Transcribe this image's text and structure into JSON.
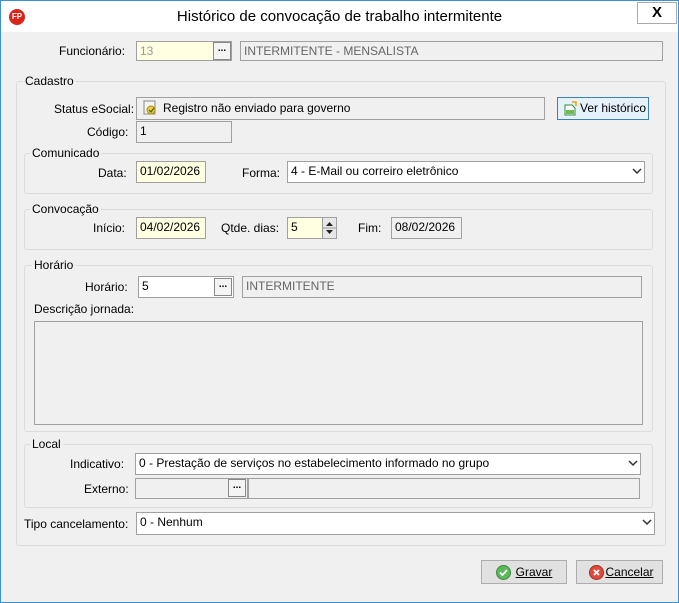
{
  "window": {
    "title": "Histórico de convocação de trabalho intermitente",
    "app_icon_text": "FP",
    "close_label": "X"
  },
  "funcionario": {
    "label": "Funcionário:",
    "value": "13",
    "description": "INTERMITENTE - MENSALISTA"
  },
  "cadastro": {
    "title": "Cadastro",
    "status_label": "Status eSocial:",
    "status_value": "Registro não enviado para governo",
    "ver_historico_label": "Ver histórico",
    "codigo_label": "Código:",
    "codigo_value": "1"
  },
  "comunicado": {
    "title": "Comunicado",
    "data_label": "Data:",
    "data_value": "01/02/2026",
    "forma_label": "Forma:",
    "forma_value": "4 - E-Mail ou correiro eletrônico"
  },
  "convocacao": {
    "title": "Convocação",
    "inicio_label": "Início:",
    "inicio_value": "04/02/2026",
    "qtde_label": "Qtde. dias:",
    "qtde_value": "5",
    "fim_label": "Fim:",
    "fim_value": "08/02/2026"
  },
  "horario": {
    "title": "Horário",
    "horario_label": "Horário:",
    "horario_value": "5",
    "horario_desc": "INTERMITENTE",
    "descricao_label": "Descrição jornada:",
    "descricao_value": ""
  },
  "local": {
    "title": "Local",
    "indicativo_label": "Indicativo:",
    "indicativo_value": "0 - Prestação de serviços no estabelecimento informado no grupo",
    "externo_label": "Externo:",
    "externo_value": "",
    "externo_desc": ""
  },
  "tipo_cancelamento": {
    "label": "Tipo cancelamento:",
    "value": "0 - Nenhum"
  },
  "footer": {
    "gravar_label": "Gravar",
    "cancelar_label": "Cancelar"
  }
}
